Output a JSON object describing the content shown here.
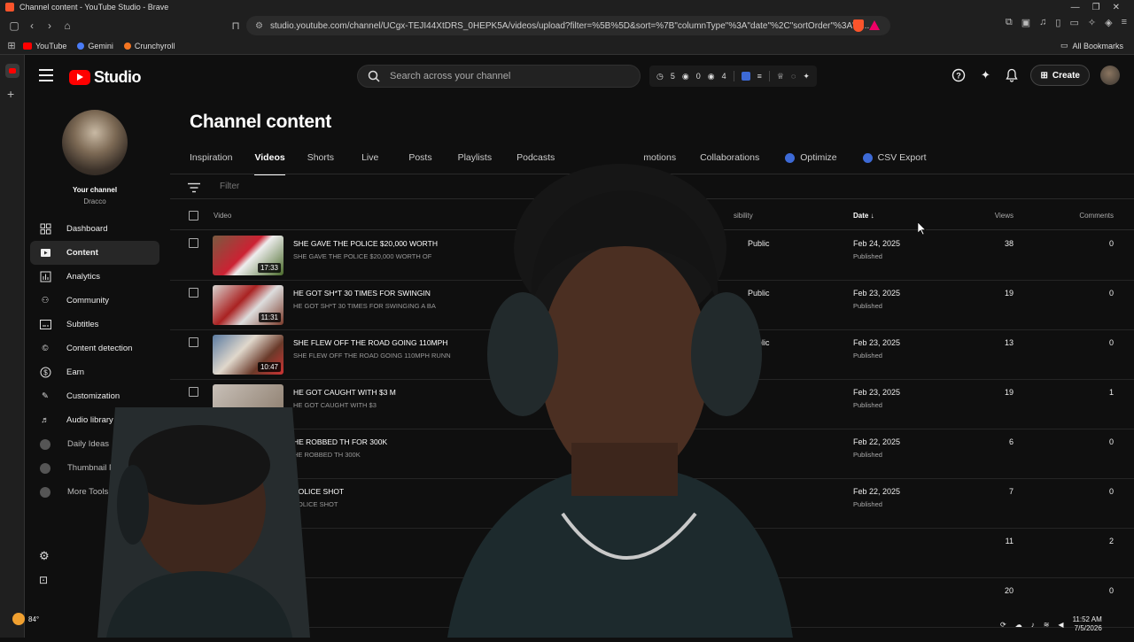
{
  "browser": {
    "window_title": "Channel content - YouTube Studio - Brave",
    "url": "studio.youtube.com/channel/UCgx-TEJI44XtDRS_0HEPK5A/videos/upload?filter=%5B%5D&sort=%7B\"columnType\"%3A\"date\"%2C\"sortOrder\"%3A\"D...",
    "bookmarks": [
      {
        "label": "YouTube",
        "color": "#ff0000"
      },
      {
        "label": "Gemini",
        "color": "#4a7cf7"
      },
      {
        "label": "Crunchyroll",
        "color": "#f47521"
      }
    ],
    "all_bookmarks": "All Bookmarks"
  },
  "header": {
    "logo_text": "Studio",
    "search_placeholder": "Search across your channel",
    "stats": {
      "a": "5",
      "b": "0",
      "c": "4"
    },
    "create_label": "Create"
  },
  "sidebar": {
    "your_channel": "Your channel",
    "channel_name": "Dracco",
    "items": [
      {
        "label": "Dashboard",
        "icon": "dashboard-icon"
      },
      {
        "label": "Content",
        "icon": "content-icon",
        "active": true
      },
      {
        "label": "Analytics",
        "icon": "analytics-icon"
      },
      {
        "label": "Community",
        "icon": "community-icon"
      },
      {
        "label": "Subtitles",
        "icon": "subtitles-icon"
      },
      {
        "label": "Content detection",
        "icon": "copyright-icon"
      },
      {
        "label": "Earn",
        "icon": "dollar-icon"
      },
      {
        "label": "Customization",
        "icon": "wand-icon"
      },
      {
        "label": "Audio library",
        "icon": "audio-library-icon"
      },
      {
        "label": "Daily Ideas",
        "icon": "extension-icon"
      },
      {
        "label": "Thumbnail Pr",
        "icon": "extension-icon"
      },
      {
        "label": "More Tools",
        "icon": "extension-icon"
      }
    ]
  },
  "main": {
    "title": "Channel content",
    "tabs": [
      {
        "label": "Inspiration"
      },
      {
        "label": "Videos",
        "active": true
      },
      {
        "label": "Shorts"
      },
      {
        "label": "Live"
      },
      {
        "label": "Posts"
      },
      {
        "label": "Playlists"
      },
      {
        "label": "Podcasts"
      },
      {
        "label": "motions"
      },
      {
        "label": "Collaborations"
      },
      {
        "label": "Optimize",
        "badge": true
      },
      {
        "label": "CSV Export",
        "badge": true
      }
    ],
    "filter_placeholder": "Filter",
    "columns": {
      "video": "Video",
      "visibility": "sibility",
      "date": "Date",
      "views": "Views",
      "comments": "Comments"
    },
    "rows": [
      {
        "title": "SHE GAVE THE POLICE $20,000 WORTH",
        "desc": "SHE GAVE THE POLICE $20,000 WORTH OF",
        "duration": "17:33",
        "visibility": "Public",
        "date": "Feb 24, 2025",
        "status": "Published",
        "views": "38",
        "comments": "0"
      },
      {
        "title": "HE GOT SH*T 30 TIMES FOR SWINGIN",
        "desc": "HE GOT SH*T 30 TIMES FOR SWINGING A BA",
        "duration": "11:31",
        "visibility": "Public",
        "date": "Feb 23, 2025",
        "status": "Published",
        "views": "19",
        "comments": "0"
      },
      {
        "title": "SHE FLEW OFF THE ROAD GOING 110MPH",
        "desc": "SHE FLEW OFF THE ROAD GOING 110MPH RUNN",
        "duration": "10:47",
        "visibility": "Public",
        "date": "Feb 23, 2025",
        "status": "Published",
        "views": "13",
        "comments": "0"
      },
      {
        "title": "HE GOT CAUGHT WITH $3 M",
        "desc": "HE GOT CAUGHT WITH $3",
        "duration": "",
        "visibility": "",
        "date": "Feb 23, 2025",
        "status": "Published",
        "views": "19",
        "comments": "1"
      },
      {
        "title": "HE ROBBED TH          FOR 300K",
        "desc": "HE ROBBED TH          300K",
        "duration": "",
        "visibility": "",
        "date": "Feb 22, 2025",
        "status": "Published",
        "views": "6",
        "comments": "0"
      },
      {
        "title": "POLICE SHOT",
        "desc": "POLICE SHOT",
        "duration": "",
        "visibility": "",
        "date": "Feb 22, 2025",
        "status": "Published",
        "views": "7",
        "comments": "0"
      },
      {
        "title": "",
        "desc": "",
        "duration": "",
        "visibility": "",
        "date": "",
        "status": "",
        "views": "11",
        "comments": "2"
      },
      {
        "title": "",
        "desc": "",
        "duration": "",
        "visibility": "",
        "date": "",
        "status": "",
        "views": "20",
        "comments": "0"
      }
    ]
  },
  "taskbar": {
    "time": "11:52 AM",
    "date": "7/5/2026",
    "weather": "84°"
  }
}
